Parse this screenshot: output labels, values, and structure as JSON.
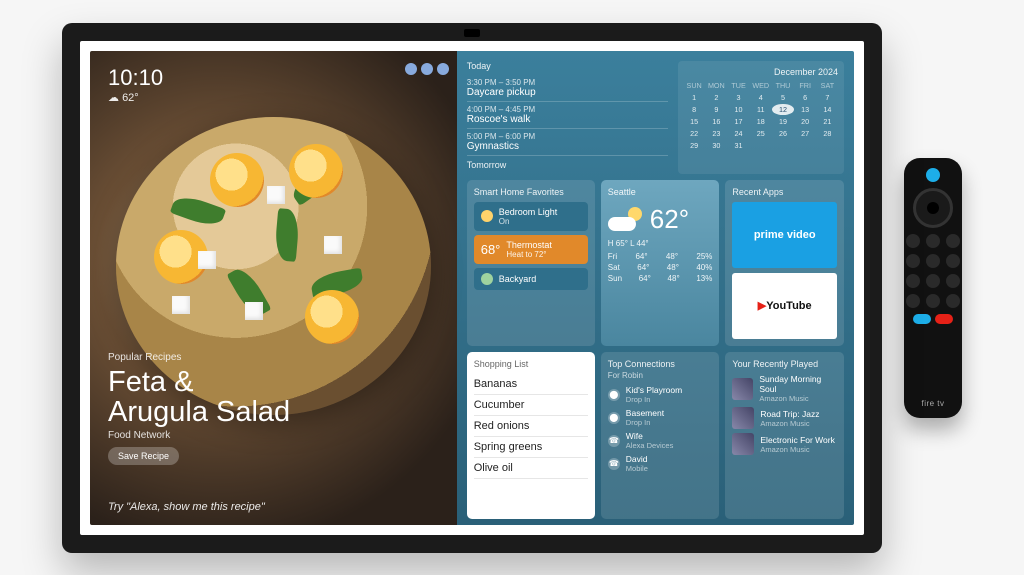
{
  "clock": {
    "time": "10:10",
    "temp": "62°"
  },
  "recipe": {
    "category": "Popular Recipes",
    "title_line1": "Feta &",
    "title_line2": "Arugula Salad",
    "source": "Food Network",
    "save_label": "Save Recipe",
    "hint": "Try \"Alexa, show me this recipe\""
  },
  "agenda": {
    "today_label": "Today",
    "tomorrow_label": "Tomorrow",
    "events": [
      {
        "time": "3:30 PM – 3:50 PM",
        "name": "Daycare pickup"
      },
      {
        "time": "4:00 PM – 4:45 PM",
        "name": "Roscoe's walk"
      },
      {
        "time": "5:00 PM – 6:00 PM",
        "name": "Gymnastics"
      }
    ]
  },
  "calendar": {
    "month": "December 2024",
    "dow": [
      "SUN",
      "MON",
      "TUE",
      "WED",
      "THU",
      "FRI",
      "SAT"
    ],
    "days": [
      "1",
      "2",
      "3",
      "4",
      "5",
      "6",
      "7",
      "8",
      "9",
      "10",
      "11",
      "12",
      "13",
      "14",
      "15",
      "16",
      "17",
      "18",
      "19",
      "20",
      "21",
      "22",
      "23",
      "24",
      "25",
      "26",
      "27",
      "28",
      "29",
      "30",
      "31"
    ],
    "today": "12"
  },
  "smarthome": {
    "title": "Smart Home Favorites",
    "light": {
      "name": "Bedroom Light",
      "state": "On"
    },
    "thermostat": {
      "current": "68°",
      "name": "Thermostat",
      "target": "Heat to 72°"
    },
    "backyard": {
      "name": "Backyard"
    }
  },
  "weather": {
    "city": "Seattle",
    "now": "62°",
    "hi_lo": "H 65°   L 44°",
    "forecast": [
      {
        "d": "Fri",
        "h": "64°",
        "l": "48°",
        "p": "25%"
      },
      {
        "d": "Sat",
        "h": "64°",
        "l": "48°",
        "p": "40%"
      },
      {
        "d": "Sun",
        "h": "64°",
        "l": "48°",
        "p": "13%"
      }
    ]
  },
  "apps": {
    "title": "Recent Apps",
    "prime": "prime video",
    "youtube_a": "▶ ",
    "youtube_b": "YouTube"
  },
  "shopping": {
    "title": "Shopping List",
    "items": [
      "Bananas",
      "Cucumber",
      "Red onions",
      "Spring greens",
      "Olive oil"
    ]
  },
  "connections": {
    "title": "Top Connections",
    "sub": "For Robin",
    "items": [
      {
        "name": "Kid's Playroom",
        "meta": "Drop In"
      },
      {
        "name": "Basement",
        "meta": "Drop In"
      },
      {
        "name": "Wife",
        "meta": "Alexa Devices"
      },
      {
        "name": "David",
        "meta": "Mobile"
      }
    ]
  },
  "played": {
    "title": "Your Recently Played",
    "items": [
      {
        "name": "Sunday Morning Soul",
        "meta": "Amazon Music"
      },
      {
        "name": "Road Trip: Jazz",
        "meta": "Amazon Music"
      },
      {
        "name": "Electronic For Work",
        "meta": "Amazon Music"
      }
    ]
  },
  "remote": {
    "brand": "fire tv"
  }
}
